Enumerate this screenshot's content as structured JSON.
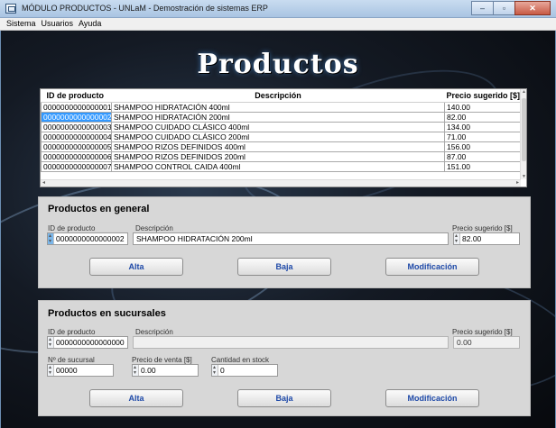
{
  "window": {
    "title": "MÓDULO PRODUCTOS - UNLaM - Demostración de sistemas ERP",
    "controls": [
      "‒",
      "▫",
      "✕"
    ]
  },
  "menu": [
    "Sistema",
    "Usuarios",
    "Ayuda"
  ],
  "page_title": "Productos",
  "grid": {
    "headers": [
      "ID de producto",
      "Descripción",
      "Precio sugerido [$]"
    ],
    "rows": [
      [
        "0000000000000001",
        "SHAMPOO HIDRATACIÓN 400ml",
        "140.00"
      ],
      [
        "0000000000000002",
        "SHAMPOO HIDRATACIÓN 200ml",
        "82.00"
      ],
      [
        "0000000000000003",
        "SHAMPOO CUIDADO CLÁSICO 400ml",
        "134.00"
      ],
      [
        "0000000000000004",
        "SHAMPOO CUIDADO CLÁSICO 200ml",
        "71.00"
      ],
      [
        "0000000000000005",
        "SHAMPOO RIZOS DEFINIDOS 400ml",
        "156.00"
      ],
      [
        "0000000000000006",
        "SHAMPOO RIZOS DEFINIDOS 200ml",
        "87.00"
      ],
      [
        "0000000000000007",
        "SHAMPOO CONTROL CAIDA 400ml",
        "151.00"
      ]
    ],
    "selected_row": 2
  },
  "general": {
    "title": "Productos en general",
    "id_label": "ID de producto",
    "id_value": "0000000000000002",
    "desc_label": "Descripción",
    "desc_value": "SHAMPOO HIDRATACIÓN 200ml",
    "price_label": "Precio sugerido [$]",
    "price_value": "82.00",
    "buttons": {
      "alta": "Alta",
      "baja": "Baja",
      "modificacion": "Modificación"
    }
  },
  "sucursales": {
    "title": "Productos en sucursales",
    "id_label": "ID de producto",
    "id_value": "0000000000000000",
    "desc_label": "Descripción",
    "desc_value": "",
    "price_label": "Precio sugerido [$]",
    "price_value": "0.00",
    "branch_label": "Nº de sucursal",
    "branch_value": "00000",
    "sale_price_label": "Precio de venta [$]",
    "sale_price_value": "0.00",
    "stock_label": "Cantidad en stock",
    "stock_value": "0",
    "buttons": {
      "alta": "Alta",
      "baja": "Baja",
      "modificacion": "Modificación"
    }
  }
}
